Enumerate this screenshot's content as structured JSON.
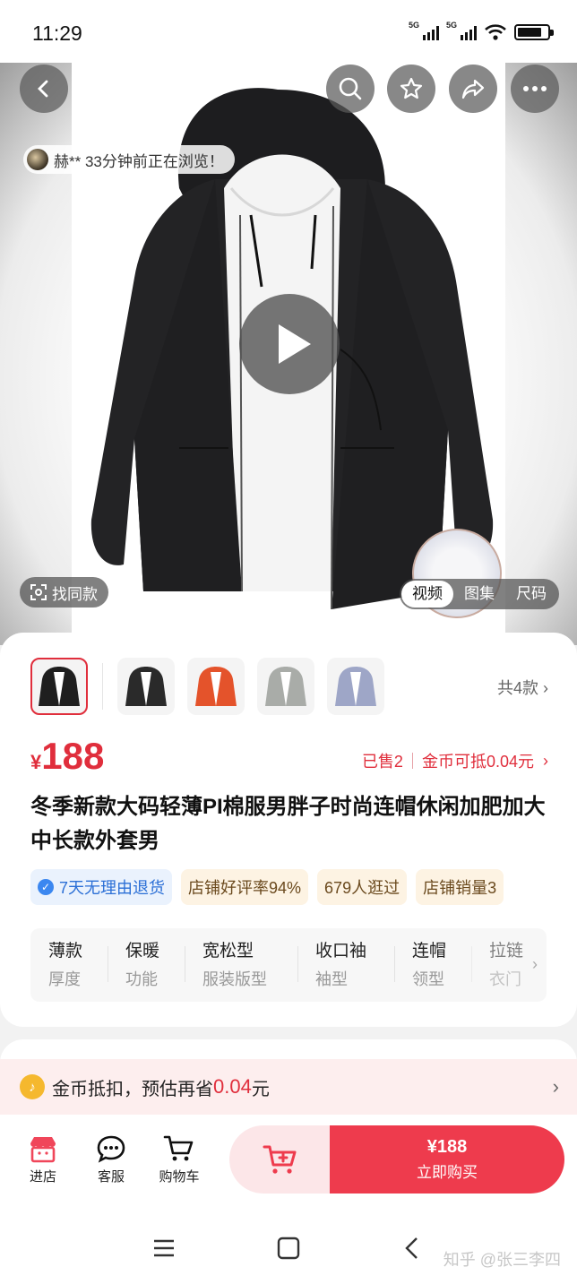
{
  "status_bar": {
    "time": "11:29",
    "signal_label": "5G",
    "battery_level": 0.8
  },
  "hero": {
    "browse_tip": "赫** 33分钟前正在浏览！",
    "find_same": "找同款",
    "media_tabs": [
      "视频",
      "图集",
      "尺码"
    ],
    "active_media_tab": "视频"
  },
  "variants": {
    "count_label": "共4款"
  },
  "product": {
    "currency": "¥",
    "price": "188",
    "sold": "已售2",
    "coin_deduct": "金币可抵0.04元",
    "title": "冬季新款大码轻薄PI棉服男胖子时尚连帽休闲加肥加大中长款外套男"
  },
  "tags": [
    {
      "label": "7天无理由退货",
      "style": "blue"
    },
    {
      "label": "店铺好评率94%",
      "style": "gold"
    },
    {
      "label": "679人逛过",
      "style": "gold"
    },
    {
      "label": "店铺销量3",
      "style": "gold"
    }
  ],
  "attributes": [
    {
      "value": "薄款",
      "key": "厚度"
    },
    {
      "value": "保暖",
      "key": "功能"
    },
    {
      "value": "宽松型",
      "key": "服装版型"
    },
    {
      "value": "收口袖",
      "key": "袖型"
    },
    {
      "value": "连帽",
      "key": "领型"
    },
    {
      "value": "拉链",
      "key": "衣门"
    }
  ],
  "coin_bar": {
    "text": "金币抵扣，预估再省",
    "amount": "0.04",
    "unit": "元"
  },
  "action_bar": {
    "store": "进店",
    "service": "客服",
    "cart": "购物车",
    "buy_price": "¥188",
    "buy_label": "立即购买"
  },
  "watermark": "知乎 @张三李四",
  "colors": {
    "accent": "#ee3b4d",
    "price": "#e02e3c",
    "coin": "#f5b82e"
  }
}
